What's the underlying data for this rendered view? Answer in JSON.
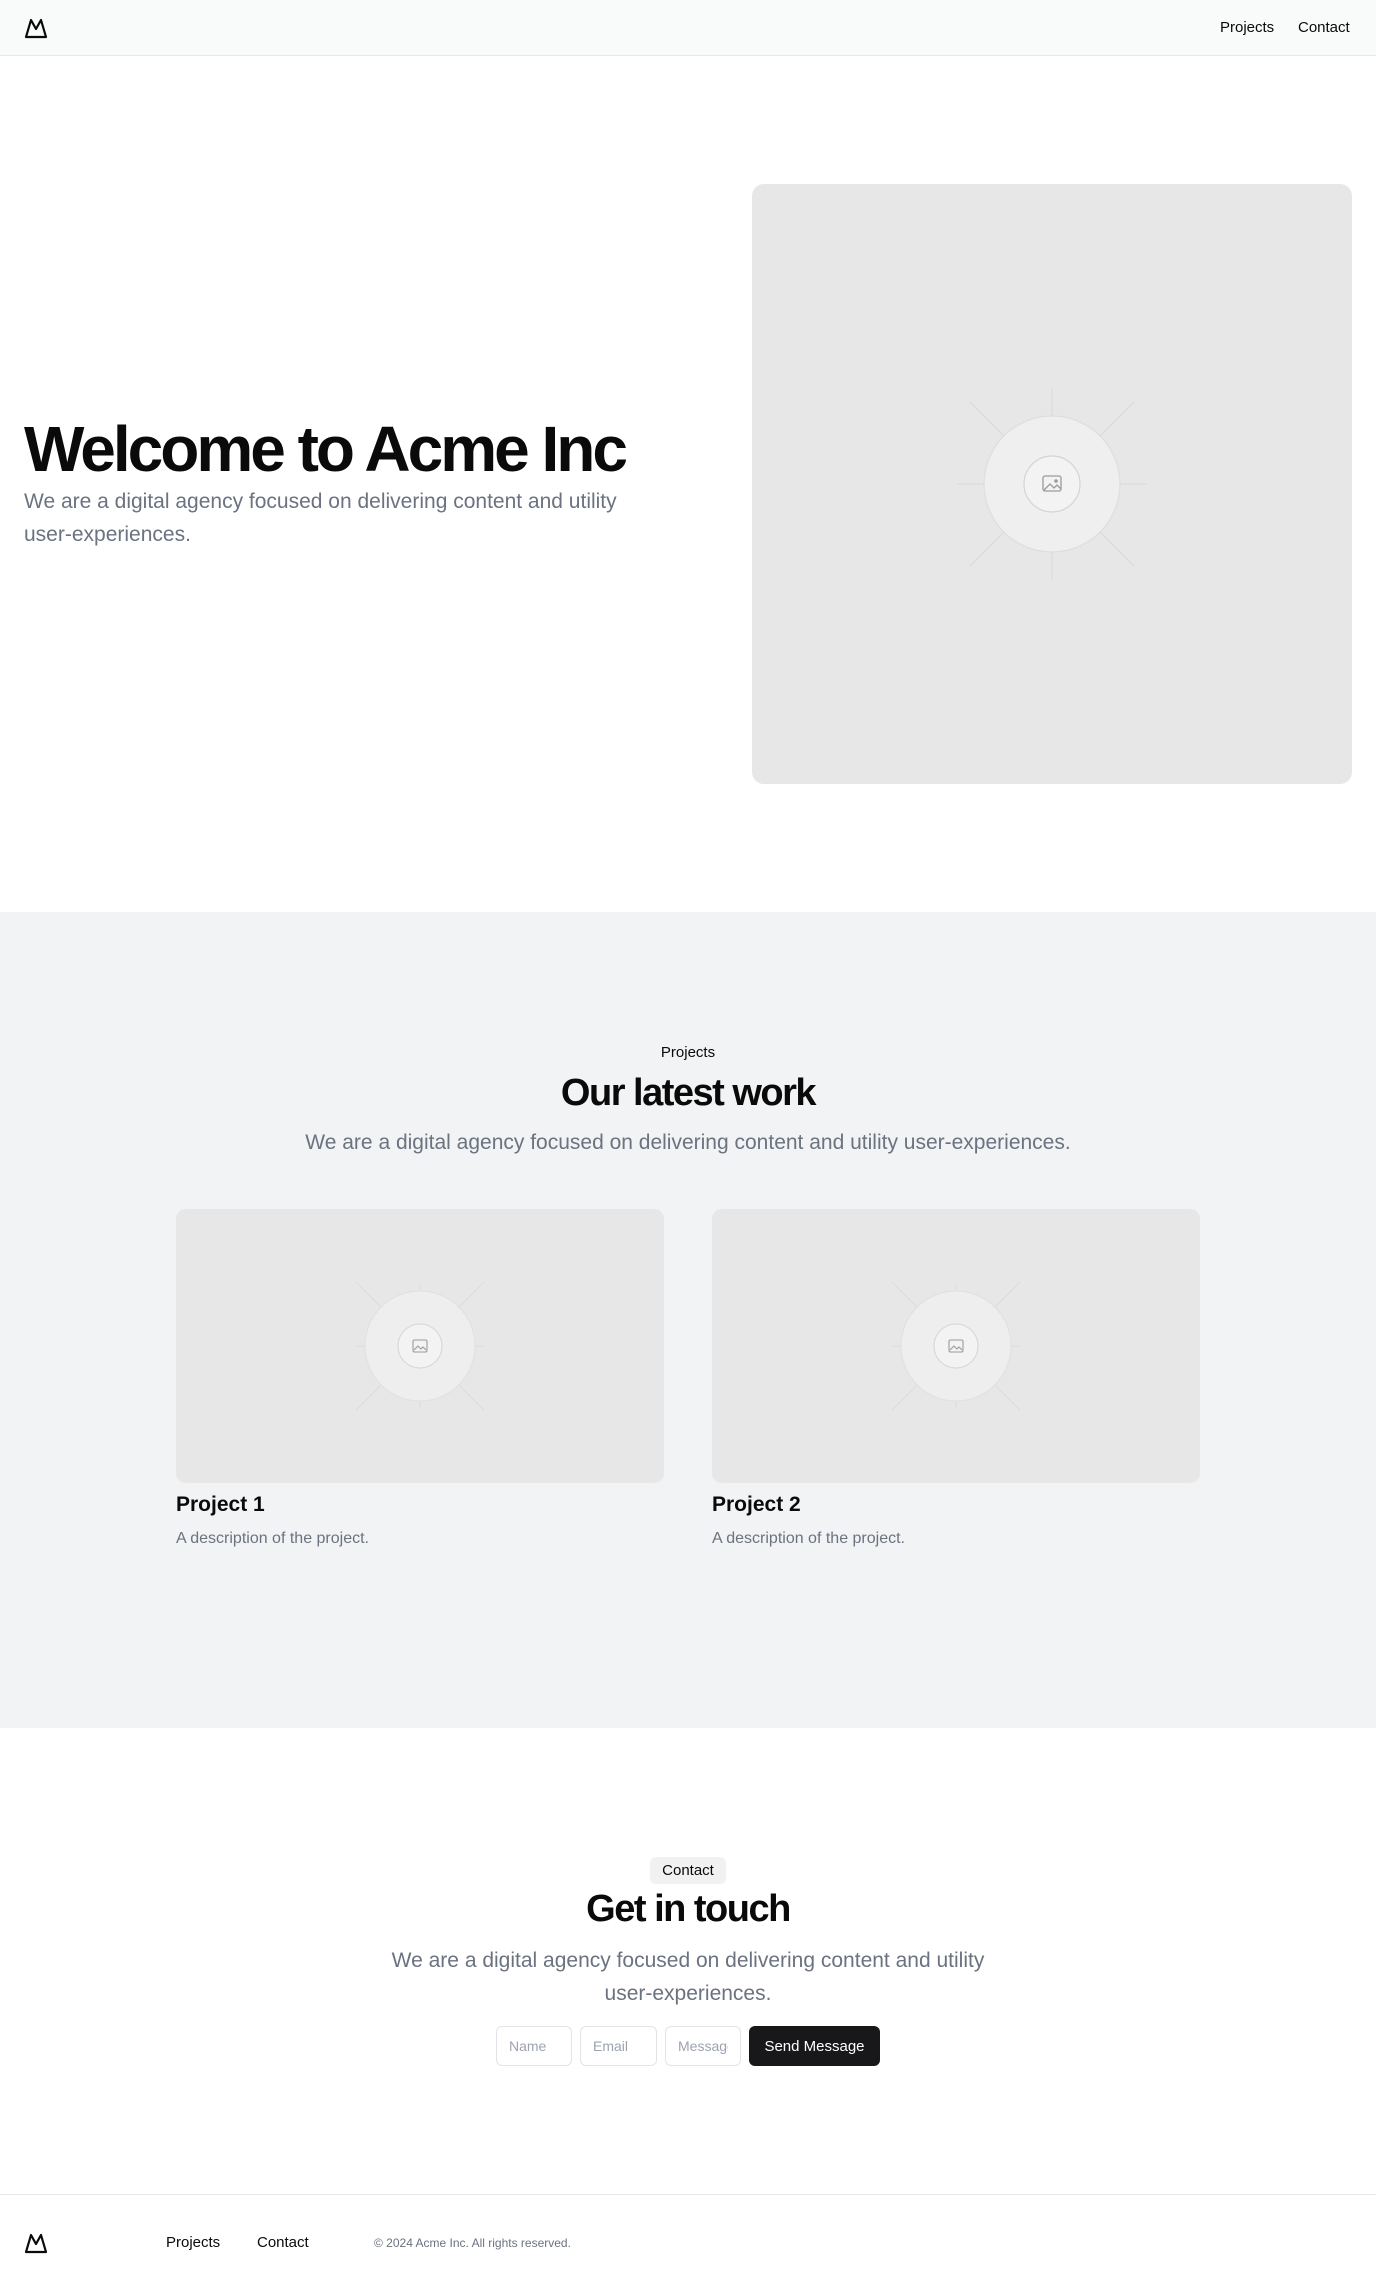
{
  "header": {
    "nav": [
      {
        "label": "Projects"
      },
      {
        "label": "Contact"
      }
    ]
  },
  "hero": {
    "title": "Welcome to Acme Inc",
    "subtitle": "We are a digital agency focused on delivering content and utility user-experiences."
  },
  "projects": {
    "eyebrow": "Projects",
    "title": "Our latest work",
    "subtitle": "We are a digital agency focused on delivering content and utility user-experiences.",
    "items": [
      {
        "title": "Project 1",
        "description": "A description of the project."
      },
      {
        "title": "Project 2",
        "description": "A description of the project."
      }
    ]
  },
  "contact": {
    "badge": "Contact",
    "title": "Get in touch",
    "subtitle": "We are a digital agency focused on delivering content and utility user-experiences.",
    "form": {
      "name_placeholder": "Name",
      "email_placeholder": "Email",
      "message_placeholder": "Message",
      "submit_label": "Send Message"
    }
  },
  "footer": {
    "nav": [
      {
        "label": "Projects"
      },
      {
        "label": "Contact"
      }
    ],
    "copyright": "© 2024 Acme Inc. All rights reserved."
  },
  "icons": {
    "logo": "mountain-icon",
    "placeholder": "image-placeholder-icon"
  },
  "colors": {
    "accent_button": "#18181b",
    "muted_text": "#6b7280",
    "section_bg": "#f2f3f4",
    "image_placeholder_bg": "#e7e7e7"
  }
}
